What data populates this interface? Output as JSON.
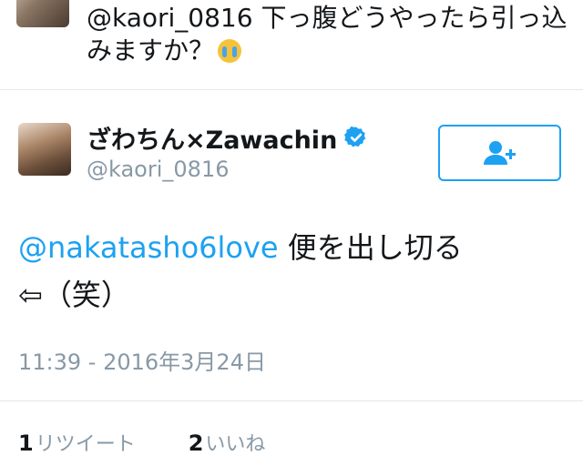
{
  "previous_tweet": {
    "text": "@kaori_0816 下っ腹どうやったら引っ込みますか？"
  },
  "tweet": {
    "display_name": "ざわちん×Zawachin",
    "handle": "@kaori_0816",
    "mention": "@nakatasho6love",
    "text_after_mention": " 便を出し切る",
    "text_line2": "⇦（笑）",
    "timestamp": "11:39 - 2016年3月24日",
    "retweet_count": "1",
    "retweet_label": "リツイート",
    "like_count": "2",
    "like_label": "いいね"
  },
  "colors": {
    "accent": "#1da1f2",
    "muted": "#8899a6"
  }
}
